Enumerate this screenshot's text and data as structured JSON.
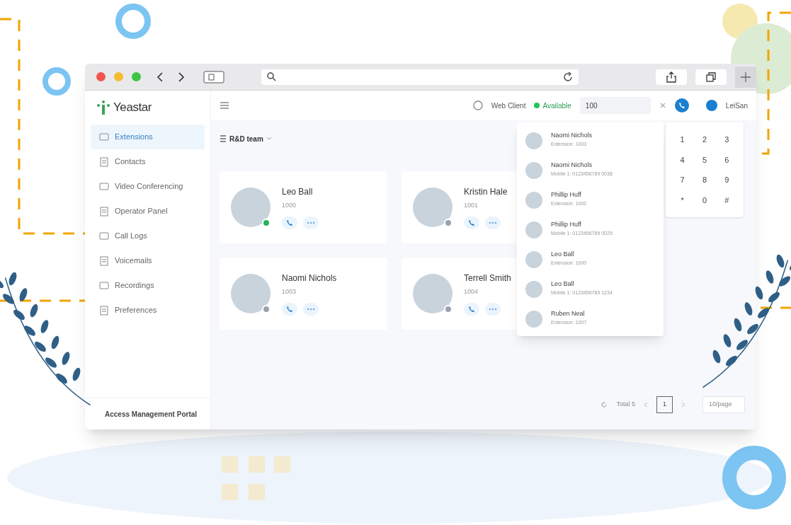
{
  "app": {
    "logo": "Yeastar",
    "sidebar": {
      "items": [
        {
          "label": "Extensions",
          "selected": true
        },
        {
          "label": "Contacts",
          "selected": false
        },
        {
          "label": "Video Conferencing",
          "selected": false
        },
        {
          "label": "Operator Panel",
          "selected": false
        },
        {
          "label": "Call Logs",
          "selected": false
        },
        {
          "label": "Voicemails",
          "selected": false
        },
        {
          "label": "Recordings",
          "selected": false
        },
        {
          "label": "Preferences",
          "selected": false
        }
      ],
      "footer": "Access Management Portal"
    },
    "header": {
      "web_client": "Web Client",
      "status": {
        "label": "Available",
        "color": "#22c55e"
      },
      "dial_input": "100",
      "user": "LeiSan"
    },
    "group_selector": "R&D team",
    "contacts": [
      {
        "name": "Leo Ball",
        "extension": "1000",
        "online": true
      },
      {
        "name": "Kristin Hale",
        "extension": "1001",
        "online": false
      },
      {
        "name": "Naomi Nichols",
        "extension": "1003",
        "online": false
      },
      {
        "name": "Terrell Smith",
        "extension": "1004",
        "online": false
      }
    ],
    "search_results": [
      {
        "name": "Naomi Nichols",
        "detail": "Extension: 1003"
      },
      {
        "name": "Naomi Nichols",
        "detail": "Mobile 1: 0123456789 0038"
      },
      {
        "name": "Phillip Huff",
        "detail": "Extension: 1002"
      },
      {
        "name": "Phillip Huff",
        "detail": "Mobile 1: 0123456789 0025"
      },
      {
        "name": "Leo Ball",
        "detail": "Extension: 1000"
      },
      {
        "name": "Leo Ball",
        "detail": "Mobile 1: 0123456789 1234"
      },
      {
        "name": "Ruben Neal",
        "detail": "Extension: 1007"
      }
    ],
    "keypad": [
      "1",
      "2",
      "3",
      "4",
      "5",
      "6",
      "7",
      "8",
      "9",
      "*",
      "0",
      "#"
    ],
    "pagination": {
      "total": "Total 5",
      "page": "1",
      "page_size": "10/page"
    }
  }
}
